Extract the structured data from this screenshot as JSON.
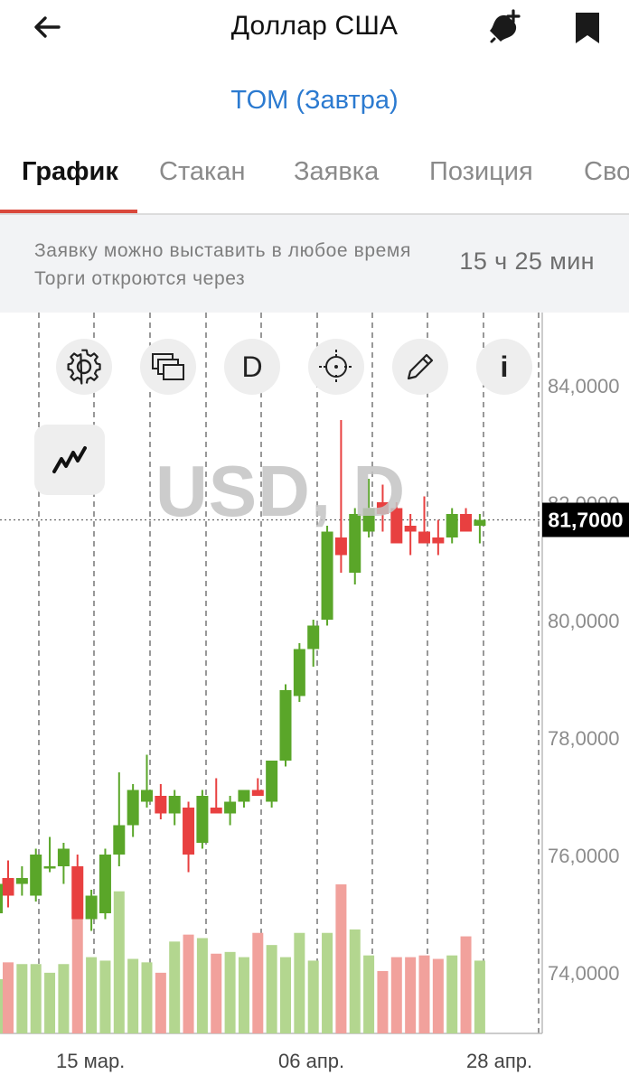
{
  "header": {
    "title": "Доллар США",
    "back_icon": "arrow-left-icon",
    "bell_icon": "bell-plus-icon",
    "bookmark_icon": "bookmark-icon"
  },
  "subtitle": "TOM (Завтра)",
  "tabs": [
    {
      "label": "График",
      "active": true
    },
    {
      "label": "Стакан",
      "active": false
    },
    {
      "label": "Заявка",
      "active": false
    },
    {
      "label": "Позиция",
      "active": false
    },
    {
      "label": "Сво",
      "active": false
    }
  ],
  "notice": {
    "text": "Заявку можно выставить в любое время Торги откроются через",
    "timer": "15 ч 25 мин"
  },
  "toolbar": {
    "settings_icon": "gear-icon",
    "layers_icon": "layers-icon",
    "period_label": "D",
    "crosshair_icon": "crosshair-icon",
    "pencil_icon": "pencil-icon",
    "info_label": "i",
    "indicator_icon": "indicator-line-icon"
  },
  "colors": {
    "up": "#5aa629",
    "down": "#e84040",
    "up_volume": "#b3d68f",
    "down_volume": "#f1a19c",
    "accent": "#2b7ad0",
    "tab_underline": "#d9483b"
  },
  "chart_data": {
    "type": "candlestick",
    "watermark": "USD, D",
    "current_price_label": "81,7000",
    "current_price": 81.7,
    "y_tick_labels": [
      "84,0000",
      "82,0000",
      "80,0000",
      "78,0000",
      "76,0000",
      "74,0000"
    ],
    "y_ticks": [
      84,
      82,
      80,
      78,
      76,
      74
    ],
    "x_tick_labels": [
      "15 мар.",
      "06 апр.",
      "28 апр."
    ],
    "grid": true,
    "candles": [
      {
        "o": 75.6,
        "h": 75.9,
        "l": 75.1,
        "c": 75.3
      },
      {
        "o": 75.5,
        "h": 75.8,
        "l": 75.3,
        "c": 75.6
      },
      {
        "o": 75.3,
        "h": 76.1,
        "l": 75.2,
        "c": 76.0
      },
      {
        "o": 75.8,
        "h": 76.3,
        "l": 75.7,
        "c": 75.8
      },
      {
        "o": 75.8,
        "h": 76.2,
        "l": 75.5,
        "c": 76.1
      },
      {
        "o": 75.8,
        "h": 76.0,
        "l": 74.9,
        "c": 74.9
      },
      {
        "o": 74.9,
        "h": 75.4,
        "l": 74.7,
        "c": 75.3
      },
      {
        "o": 75.0,
        "h": 76.1,
        "l": 74.9,
        "c": 76.0
      },
      {
        "o": 76.0,
        "h": 77.4,
        "l": 75.8,
        "c": 76.5
      },
      {
        "o": 76.5,
        "h": 77.2,
        "l": 76.3,
        "c": 77.1
      },
      {
        "o": 76.9,
        "h": 77.7,
        "l": 76.8,
        "c": 77.1
      },
      {
        "o": 77.0,
        "h": 77.2,
        "l": 76.6,
        "c": 76.7
      },
      {
        "o": 76.7,
        "h": 77.1,
        "l": 76.5,
        "c": 77.0
      },
      {
        "o": 76.8,
        "h": 76.9,
        "l": 75.7,
        "c": 76.0
      },
      {
        "o": 76.2,
        "h": 77.1,
        "l": 76.1,
        "c": 77.0
      },
      {
        "o": 76.8,
        "h": 77.3,
        "l": 76.7,
        "c": 76.7
      },
      {
        "o": 76.7,
        "h": 77.0,
        "l": 76.5,
        "c": 76.9
      },
      {
        "o": 76.9,
        "h": 77.1,
        "l": 76.8,
        "c": 77.1
      },
      {
        "o": 77.1,
        "h": 77.3,
        "l": 77.0,
        "c": 77.0
      },
      {
        "o": 76.9,
        "h": 77.6,
        "l": 76.8,
        "c": 77.6
      },
      {
        "o": 77.6,
        "h": 78.9,
        "l": 77.5,
        "c": 78.8
      },
      {
        "o": 78.7,
        "h": 79.6,
        "l": 78.6,
        "c": 79.5
      },
      {
        "o": 79.5,
        "h": 80.0,
        "l": 79.2,
        "c": 79.9
      },
      {
        "o": 80.0,
        "h": 81.6,
        "l": 79.9,
        "c": 81.5
      },
      {
        "o": 81.4,
        "h": 83.4,
        "l": 80.8,
        "c": 81.1
      },
      {
        "o": 80.8,
        "h": 81.9,
        "l": 80.6,
        "c": 81.8
      },
      {
        "o": 81.5,
        "h": 82.4,
        "l": 81.4,
        "c": 81.9
      },
      {
        "o": 82.0,
        "h": 82.3,
        "l": 81.5,
        "c": 81.8
      },
      {
        "o": 81.9,
        "h": 82.0,
        "l": 81.4,
        "c": 81.3
      },
      {
        "o": 81.6,
        "h": 81.8,
        "l": 81.1,
        "c": 81.5
      },
      {
        "o": 81.5,
        "h": 82.1,
        "l": 81.3,
        "c": 81.3
      },
      {
        "o": 81.4,
        "h": 81.7,
        "l": 81.1,
        "c": 81.3
      },
      {
        "o": 81.4,
        "h": 81.9,
        "l": 81.3,
        "c": 81.8
      },
      {
        "o": 81.8,
        "h": 81.9,
        "l": 81.5,
        "c": 81.5
      },
      {
        "o": 81.6,
        "h": 81.8,
        "l": 81.3,
        "c": 81.7
      }
    ],
    "volumes": [
      0.41,
      0.4,
      0.4,
      0.35,
      0.4,
      0.69,
      0.44,
      0.42,
      0.82,
      0.43,
      0.41,
      0.35,
      0.53,
      0.57,
      0.55,
      0.46,
      0.47,
      0.44,
      0.58,
      0.51,
      0.44,
      0.58,
      0.42,
      0.58,
      0.86,
      0.6,
      0.45,
      0.36,
      0.44,
      0.44,
      0.45,
      0.43,
      0.45,
      0.56,
      0.42
    ]
  }
}
